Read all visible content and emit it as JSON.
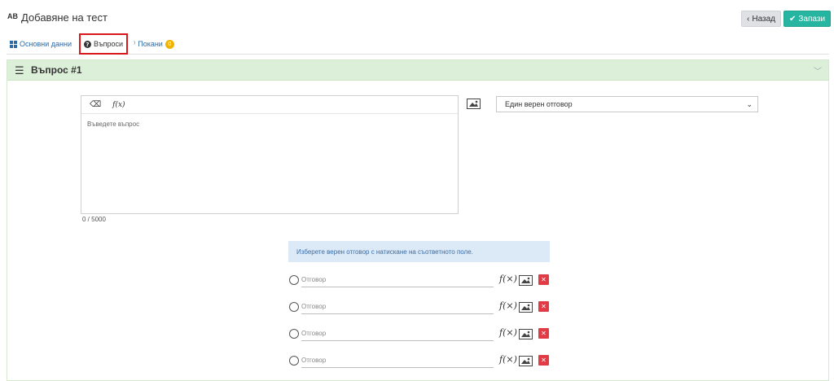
{
  "header": {
    "icon": "spell-check-icon",
    "icon_text": "AB",
    "title": "Добавяне на тест",
    "back_label": "Назад",
    "save_label": "Запази"
  },
  "tabs": [
    {
      "label": "Основни данни",
      "icon": "grid-icon"
    },
    {
      "label": "Въпроси",
      "icon": "question-circle-icon",
      "active": true
    },
    {
      "label": "Покани",
      "icon": "rss-icon",
      "badge": "0"
    }
  ],
  "question": {
    "title": "Въпрос #1",
    "editor_placeholder": "Въведете въпрос",
    "formula_label": "f(x)",
    "char_counter": "0 / 5000",
    "type_select": "Един верен отговор"
  },
  "hint": "Изберете верен отговор с натискане на съответното поле.",
  "answers": [
    {
      "placeholder": "Отговор"
    },
    {
      "placeholder": "Отговор"
    },
    {
      "placeholder": "Отговор"
    },
    {
      "placeholder": "Отговор"
    }
  ],
  "colors": {
    "accent": "#26b5a0",
    "panel_header": "#dcefd8",
    "delete": "#e13b45",
    "hint_bg": "#dce9f7",
    "highlight_border": "#d7191c",
    "link": "#2a6aa8"
  }
}
